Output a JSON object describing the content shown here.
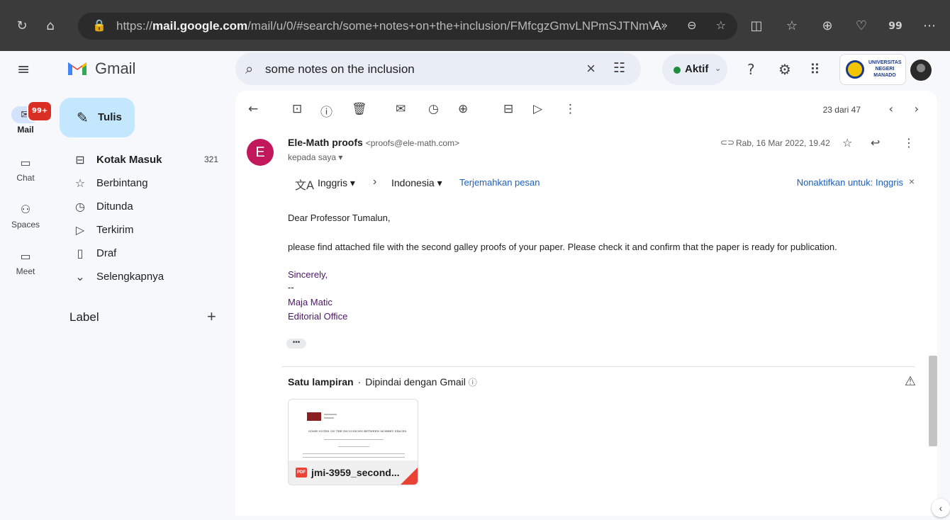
{
  "browser": {
    "url_scheme": "https://",
    "url_domain": "mail.google.com",
    "url_path": "/mail/u/0/#search/some+notes+on+the+inclusion/FMfcgzGmvLNPmSJTNmV...",
    "count": "99"
  },
  "app": {
    "name": "Gmail"
  },
  "search": {
    "query": "some notes on the inclusion"
  },
  "status": {
    "label": "Aktif"
  },
  "org": {
    "logo_text": "UNIVERSITAS NEGERI MANADO"
  },
  "rail": [
    {
      "label": "Mail",
      "badge": "99+"
    },
    {
      "label": "Chat"
    },
    {
      "label": "Spaces"
    },
    {
      "label": "Meet"
    }
  ],
  "compose": {
    "label": "Tulis"
  },
  "nav": [
    {
      "label": "Kotak Masuk",
      "count": "321"
    },
    {
      "label": "Berbintang"
    },
    {
      "label": "Ditunda"
    },
    {
      "label": "Terkirim"
    },
    {
      "label": "Draf"
    },
    {
      "label": "Selengkapnya"
    }
  ],
  "labels": {
    "heading": "Label"
  },
  "toolbar": {
    "pager": "23 dari 47"
  },
  "email": {
    "avatar_letter": "E",
    "sender_name": "Ele-Math proofs",
    "sender_email": "<proofs@ele-math.com>",
    "recipient": "kepada saya",
    "date": "Rab, 16 Mar 2022, 19.42",
    "translate": {
      "source": "Inggris",
      "target": "Indonesia",
      "action": "Terjemahkan pesan",
      "disable": "Nonaktifkan untuk: Inggris"
    },
    "body": {
      "greeting": "Dear Professor Tumalun,",
      "paragraph": "please find attached file with the second galley proofs of your paper. Please check it and confirm that the paper is ready for publication.",
      "closing": "Sincerely,",
      "dash": "--",
      "sig_name": "Maja Matic",
      "sig_office": "Editorial Office"
    },
    "ellipsis": "•••"
  },
  "attachments": {
    "heading": "Satu lampiran",
    "scan_note": "Dipindai dengan Gmail",
    "file_name": "jmi-3959_second...",
    "file_type": "PDF",
    "thumbnail_title": "SOME NOTES ON THE INCLUSIONS BETWEEN MORREY SPACES"
  }
}
